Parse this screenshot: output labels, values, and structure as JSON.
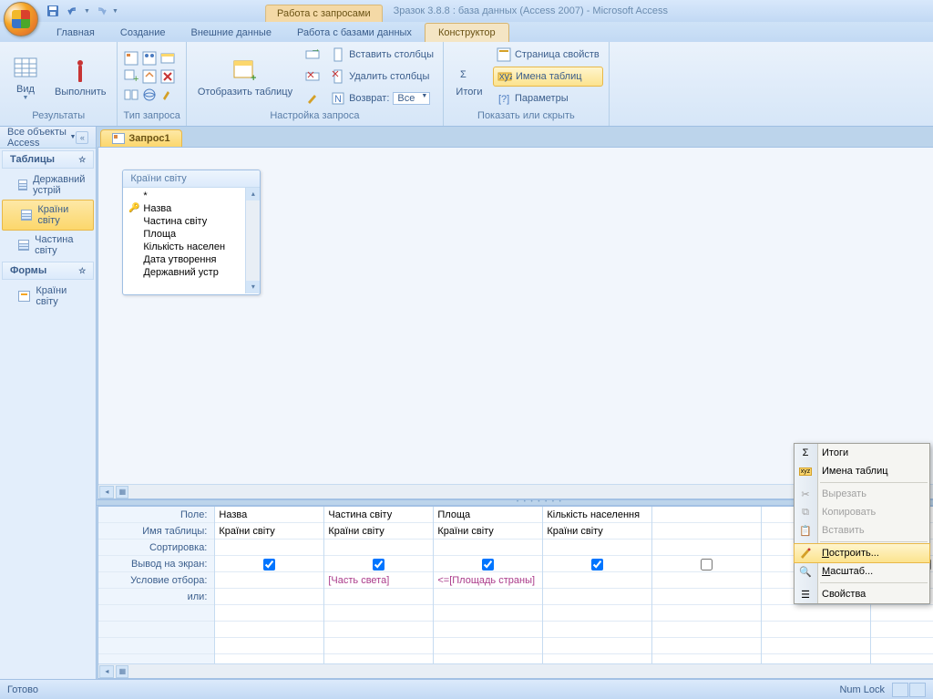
{
  "title": {
    "context_tab": "Работа с запросами",
    "doc_title": "Зразок 3.8.8 : база данных (Access 2007) - Microsoft Access"
  },
  "ribbon_tabs": [
    "Главная",
    "Создание",
    "Внешние данные",
    "Работа с базами данных",
    "Конструктор"
  ],
  "ribbon_active_tab": "Конструктор",
  "ribbon": {
    "results": {
      "view": "Вид",
      "run": "Выполнить",
      "label": "Результаты"
    },
    "query_type_label": "Тип запроса",
    "show_table": {
      "button": "Отобразить таблицу",
      "insert_cols": "Вставить столбцы",
      "delete_cols": "Удалить столбцы",
      "return_label": "Возврат:",
      "return_value": "Все",
      "label": "Настройка запроса"
    },
    "show_hide": {
      "totals": "Итоги",
      "property_sheet": "Страница свойств",
      "table_names": "Имена таблиц",
      "parameters": "Параметры",
      "label": "Показать или скрыть"
    }
  },
  "nav": {
    "header": "Все объекты Access",
    "sections": [
      {
        "title": "Таблицы",
        "items": [
          "Державний устрій",
          "Країни світу",
          "Частина світу"
        ],
        "selected_index": 1,
        "type": "table"
      },
      {
        "title": "Формы",
        "items": [
          "Країни світу"
        ],
        "selected_index": -1,
        "type": "form"
      }
    ]
  },
  "doc_tab": "Запрос1",
  "table_box": {
    "title": "Країни світу",
    "fields": [
      "*",
      "Назва",
      "Частина світу",
      "Площа",
      "Кількість населен",
      "Дата утворення",
      "Державний устр"
    ]
  },
  "grid": {
    "row_headers": [
      "Поле:",
      "Имя таблицы:",
      "Сортировка:",
      "Вывод на экран:",
      "Условие отбора:",
      "или:"
    ],
    "cols": [
      {
        "field": "Назва",
        "table": "Країни світу",
        "sort": "",
        "show": true,
        "criteria": "",
        "or": ""
      },
      {
        "field": "Частина світу",
        "table": "Країни світу",
        "sort": "",
        "show": true,
        "criteria": "[Часть света]",
        "or": ""
      },
      {
        "field": "Площа",
        "table": "Країни світу",
        "sort": "",
        "show": true,
        "criteria": "<=[Площадь страны]",
        "or": ""
      },
      {
        "field": "Кількість населення",
        "table": "Країни світу",
        "sort": "",
        "show": true,
        "criteria": "",
        "or": ""
      },
      {
        "field": "",
        "table": "",
        "sort": "",
        "show": false,
        "criteria": "",
        "or": ""
      }
    ]
  },
  "context_menu": [
    {
      "icon": "sigma",
      "label": "Итоги",
      "type": "item"
    },
    {
      "icon": "xyz",
      "label": "Имена таблиц",
      "type": "item"
    },
    {
      "type": "sep"
    },
    {
      "icon": "cut",
      "label": "Вырезать",
      "type": "item",
      "disabled": true
    },
    {
      "icon": "copy",
      "label": "Копировать",
      "type": "item",
      "disabled": true
    },
    {
      "icon": "paste",
      "label": "Вставить",
      "type": "item",
      "disabled": true
    },
    {
      "type": "sep"
    },
    {
      "icon": "build",
      "label": "Построить...",
      "type": "item",
      "highlighted": true
    },
    {
      "icon": "zoom",
      "label": "Масштаб...",
      "type": "item"
    },
    {
      "type": "sep"
    },
    {
      "icon": "props",
      "label": "Свойства",
      "type": "item"
    }
  ],
  "status": {
    "left": "Готово",
    "numlock": "Num Lock"
  }
}
